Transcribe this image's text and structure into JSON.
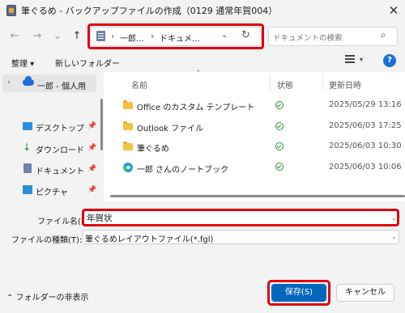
{
  "window": {
    "title": "筆ぐるめ - バックアップファイルの作成（0129 通常年賀004）",
    "close_glyph": "✕"
  },
  "nav": {
    "back_glyph": "←",
    "forward_glyph": "→",
    "recent_glyph": "⌄",
    "up_glyph": "↑"
  },
  "address": {
    "sep": "›",
    "crumbs": [
      "一郎...",
      "ドキュメ..."
    ],
    "dropdown_glyph": "⌄",
    "refresh_glyph": "↻"
  },
  "search": {
    "placeholder": "ドキュメントの検索",
    "icon": "search-icon",
    "glyph": "⌕"
  },
  "toolbar": {
    "organize_label": "整理 ▾",
    "new_folder_label": "新しいフォルダー",
    "view_dropdown_glyph": "▾",
    "help_glyph": "?"
  },
  "sidebar": {
    "chevron": "›",
    "onedrive_label": "一郎 - 個人用",
    "pin_glyph": "📌",
    "items": [
      {
        "label": "デスクトップ",
        "icon": "desktop-icon",
        "color": "#2a90e0"
      },
      {
        "label": "ダウンロード",
        "icon": "download-icon",
        "color": "#2f7f3a"
      },
      {
        "label": "ドキュメント",
        "icon": "document-icon",
        "color": "#6d83a8"
      },
      {
        "label": "ピクチャ",
        "icon": "pictures-icon",
        "color": "#2a8fd8"
      }
    ]
  },
  "file_list": {
    "sort_glyph": "⌃",
    "columns": [
      "名前",
      "状態",
      "更新日時"
    ],
    "rows": [
      {
        "name": "Office のカスタム テンプレート",
        "type": "folder",
        "date": "2025/05/29 13:16"
      },
      {
        "name": "Outlook ファイル",
        "type": "folder",
        "date": "2025/06/03 17:25"
      },
      {
        "name": "筆ぐるめ",
        "type": "folder",
        "date": "2025/06/03 10:30"
      },
      {
        "name": "一郎 さんのノートブック",
        "type": "notebook",
        "date": "2025/06/03 10:06"
      }
    ]
  },
  "form": {
    "filename_label": "ファイル名(N):",
    "filename_value": "年賀状",
    "filetype_label": "ファイルの種類(T):",
    "filetype_value": "筆ぐるめレイアウトファイル(*.fgl)",
    "dropdown_glyph": "⌄"
  },
  "footer": {
    "hide_folders_label": "⌃ フォルダーの非表示",
    "save_label": "保存(S)",
    "cancel_label": "キャンセル"
  },
  "colors": {
    "accent": "#0067c0",
    "highlight": "#e00010"
  }
}
